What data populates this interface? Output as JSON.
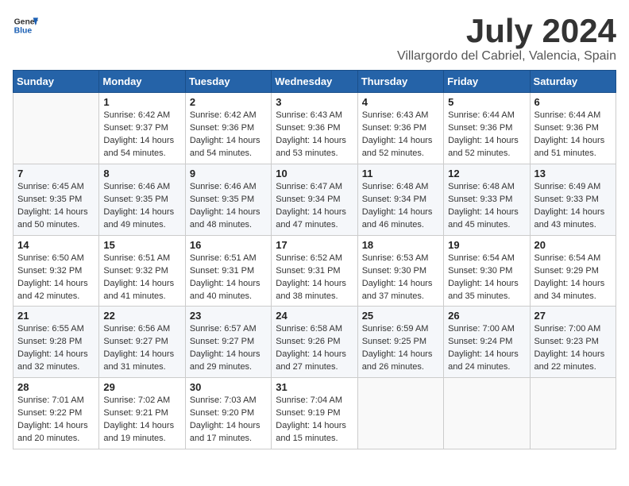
{
  "logo": {
    "general": "General",
    "blue": "Blue"
  },
  "title": "July 2024",
  "subtitle": "Villargordo del Cabriel, Valencia, Spain",
  "days_of_week": [
    "Sunday",
    "Monday",
    "Tuesday",
    "Wednesday",
    "Thursday",
    "Friday",
    "Saturday"
  ],
  "weeks": [
    [
      {
        "day": "",
        "sunrise": "",
        "sunset": "",
        "daylight": ""
      },
      {
        "day": "1",
        "sunrise": "Sunrise: 6:42 AM",
        "sunset": "Sunset: 9:37 PM",
        "daylight": "Daylight: 14 hours and 54 minutes."
      },
      {
        "day": "2",
        "sunrise": "Sunrise: 6:42 AM",
        "sunset": "Sunset: 9:36 PM",
        "daylight": "Daylight: 14 hours and 54 minutes."
      },
      {
        "day": "3",
        "sunrise": "Sunrise: 6:43 AM",
        "sunset": "Sunset: 9:36 PM",
        "daylight": "Daylight: 14 hours and 53 minutes."
      },
      {
        "day": "4",
        "sunrise": "Sunrise: 6:43 AM",
        "sunset": "Sunset: 9:36 PM",
        "daylight": "Daylight: 14 hours and 52 minutes."
      },
      {
        "day": "5",
        "sunrise": "Sunrise: 6:44 AM",
        "sunset": "Sunset: 9:36 PM",
        "daylight": "Daylight: 14 hours and 52 minutes."
      },
      {
        "day": "6",
        "sunrise": "Sunrise: 6:44 AM",
        "sunset": "Sunset: 9:36 PM",
        "daylight": "Daylight: 14 hours and 51 minutes."
      }
    ],
    [
      {
        "day": "7",
        "sunrise": "Sunrise: 6:45 AM",
        "sunset": "Sunset: 9:35 PM",
        "daylight": "Daylight: 14 hours and 50 minutes."
      },
      {
        "day": "8",
        "sunrise": "Sunrise: 6:46 AM",
        "sunset": "Sunset: 9:35 PM",
        "daylight": "Daylight: 14 hours and 49 minutes."
      },
      {
        "day": "9",
        "sunrise": "Sunrise: 6:46 AM",
        "sunset": "Sunset: 9:35 PM",
        "daylight": "Daylight: 14 hours and 48 minutes."
      },
      {
        "day": "10",
        "sunrise": "Sunrise: 6:47 AM",
        "sunset": "Sunset: 9:34 PM",
        "daylight": "Daylight: 14 hours and 47 minutes."
      },
      {
        "day": "11",
        "sunrise": "Sunrise: 6:48 AM",
        "sunset": "Sunset: 9:34 PM",
        "daylight": "Daylight: 14 hours and 46 minutes."
      },
      {
        "day": "12",
        "sunrise": "Sunrise: 6:48 AM",
        "sunset": "Sunset: 9:33 PM",
        "daylight": "Daylight: 14 hours and 45 minutes."
      },
      {
        "day": "13",
        "sunrise": "Sunrise: 6:49 AM",
        "sunset": "Sunset: 9:33 PM",
        "daylight": "Daylight: 14 hours and 43 minutes."
      }
    ],
    [
      {
        "day": "14",
        "sunrise": "Sunrise: 6:50 AM",
        "sunset": "Sunset: 9:32 PM",
        "daylight": "Daylight: 14 hours and 42 minutes."
      },
      {
        "day": "15",
        "sunrise": "Sunrise: 6:51 AM",
        "sunset": "Sunset: 9:32 PM",
        "daylight": "Daylight: 14 hours and 41 minutes."
      },
      {
        "day": "16",
        "sunrise": "Sunrise: 6:51 AM",
        "sunset": "Sunset: 9:31 PM",
        "daylight": "Daylight: 14 hours and 40 minutes."
      },
      {
        "day": "17",
        "sunrise": "Sunrise: 6:52 AM",
        "sunset": "Sunset: 9:31 PM",
        "daylight": "Daylight: 14 hours and 38 minutes."
      },
      {
        "day": "18",
        "sunrise": "Sunrise: 6:53 AM",
        "sunset": "Sunset: 9:30 PM",
        "daylight": "Daylight: 14 hours and 37 minutes."
      },
      {
        "day": "19",
        "sunrise": "Sunrise: 6:54 AM",
        "sunset": "Sunset: 9:30 PM",
        "daylight": "Daylight: 14 hours and 35 minutes."
      },
      {
        "day": "20",
        "sunrise": "Sunrise: 6:54 AM",
        "sunset": "Sunset: 9:29 PM",
        "daylight": "Daylight: 14 hours and 34 minutes."
      }
    ],
    [
      {
        "day": "21",
        "sunrise": "Sunrise: 6:55 AM",
        "sunset": "Sunset: 9:28 PM",
        "daylight": "Daylight: 14 hours and 32 minutes."
      },
      {
        "day": "22",
        "sunrise": "Sunrise: 6:56 AM",
        "sunset": "Sunset: 9:27 PM",
        "daylight": "Daylight: 14 hours and 31 minutes."
      },
      {
        "day": "23",
        "sunrise": "Sunrise: 6:57 AM",
        "sunset": "Sunset: 9:27 PM",
        "daylight": "Daylight: 14 hours and 29 minutes."
      },
      {
        "day": "24",
        "sunrise": "Sunrise: 6:58 AM",
        "sunset": "Sunset: 9:26 PM",
        "daylight": "Daylight: 14 hours and 27 minutes."
      },
      {
        "day": "25",
        "sunrise": "Sunrise: 6:59 AM",
        "sunset": "Sunset: 9:25 PM",
        "daylight": "Daylight: 14 hours and 26 minutes."
      },
      {
        "day": "26",
        "sunrise": "Sunrise: 7:00 AM",
        "sunset": "Sunset: 9:24 PM",
        "daylight": "Daylight: 14 hours and 24 minutes."
      },
      {
        "day": "27",
        "sunrise": "Sunrise: 7:00 AM",
        "sunset": "Sunset: 9:23 PM",
        "daylight": "Daylight: 14 hours and 22 minutes."
      }
    ],
    [
      {
        "day": "28",
        "sunrise": "Sunrise: 7:01 AM",
        "sunset": "Sunset: 9:22 PM",
        "daylight": "Daylight: 14 hours and 20 minutes."
      },
      {
        "day": "29",
        "sunrise": "Sunrise: 7:02 AM",
        "sunset": "Sunset: 9:21 PM",
        "daylight": "Daylight: 14 hours and 19 minutes."
      },
      {
        "day": "30",
        "sunrise": "Sunrise: 7:03 AM",
        "sunset": "Sunset: 9:20 PM",
        "daylight": "Daylight: 14 hours and 17 minutes."
      },
      {
        "day": "31",
        "sunrise": "Sunrise: 7:04 AM",
        "sunset": "Sunset: 9:19 PM",
        "daylight": "Daylight: 14 hours and 15 minutes."
      },
      {
        "day": "",
        "sunrise": "",
        "sunset": "",
        "daylight": ""
      },
      {
        "day": "",
        "sunrise": "",
        "sunset": "",
        "daylight": ""
      },
      {
        "day": "",
        "sunrise": "",
        "sunset": "",
        "daylight": ""
      }
    ]
  ]
}
